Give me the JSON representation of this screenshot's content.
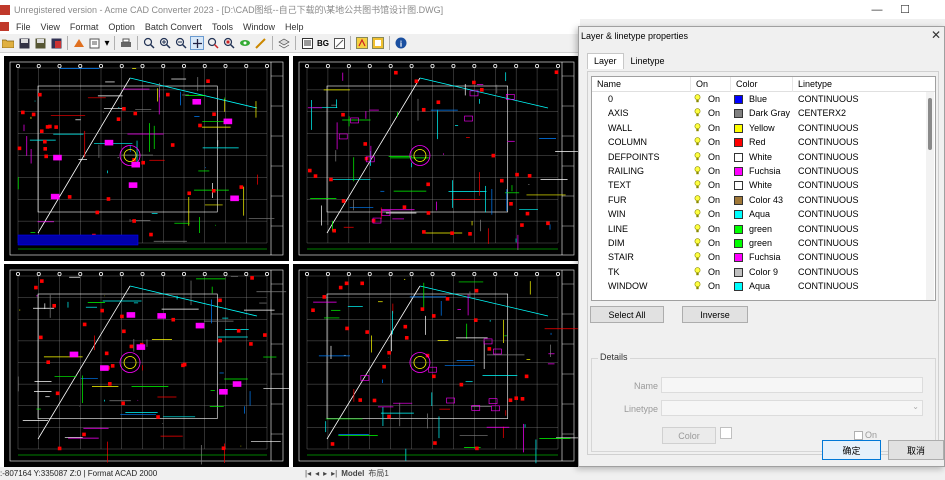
{
  "window": {
    "title": "Unregistered version - Acme CAD Converter 2023 - [D:\\CAD图纸--自己下载的\\某地公共图书馆设计图.DWG]"
  },
  "menu": [
    "File",
    "View",
    "Format",
    "Option",
    "Batch Convert",
    "Tools",
    "Window",
    "Help"
  ],
  "status": {
    "coords": ":-807164 Y:335087 Z:0 | Format ACAD 2000",
    "nav": [
      "|◂",
      "◂",
      "▸",
      "▸|"
    ],
    "tabs": [
      "Model",
      "布局1"
    ]
  },
  "dialog": {
    "title": "Layer & linetype properties",
    "tabs": [
      "Layer",
      "Linetype"
    ],
    "columns": [
      "Name",
      "On",
      "Color",
      "Linetype"
    ],
    "layers": [
      {
        "name": "0",
        "on": "On",
        "color_name": "Blue",
        "color": "#0000ff",
        "linetype": "CONTINUOUS"
      },
      {
        "name": "AXIS",
        "on": "On",
        "color_name": "Dark Gray",
        "color": "#808080",
        "linetype": "CENTERX2"
      },
      {
        "name": "WALL",
        "on": "On",
        "color_name": "Yellow",
        "color": "#ffff00",
        "linetype": "CONTINUOUS"
      },
      {
        "name": "COLUMN",
        "on": "On",
        "color_name": "Red",
        "color": "#ff0000",
        "linetype": "CONTINUOUS"
      },
      {
        "name": "DEFPOINTS",
        "on": "On",
        "color_name": "White",
        "color": "#ffffff",
        "linetype": "CONTINUOUS"
      },
      {
        "name": "RAILING",
        "on": "On",
        "color_name": "Fuchsia",
        "color": "#ff00ff",
        "linetype": "CONTINUOUS"
      },
      {
        "name": "TEXT",
        "on": "On",
        "color_name": "White",
        "color": "#ffffff",
        "linetype": "CONTINUOUS"
      },
      {
        "name": "FUR",
        "on": "On",
        "color_name": "Color 43",
        "color": "#a07838",
        "linetype": "CONTINUOUS"
      },
      {
        "name": "WIN",
        "on": "On",
        "color_name": "Aqua",
        "color": "#00ffff",
        "linetype": "CONTINUOUS"
      },
      {
        "name": "LINE",
        "on": "On",
        "color_name": "green",
        "color": "#00ff00",
        "linetype": "CONTINUOUS"
      },
      {
        "name": "DIM",
        "on": "On",
        "color_name": "green",
        "color": "#00ff00",
        "linetype": "CONTINUOUS"
      },
      {
        "name": "STAIR",
        "on": "On",
        "color_name": "Fuchsia",
        "color": "#ff00ff",
        "linetype": "CONTINUOUS"
      },
      {
        "name": "TK",
        "on": "On",
        "color_name": "Color 9",
        "color": "#c0c0c0",
        "linetype": "CONTINUOUS"
      },
      {
        "name": "WINDOW",
        "on": "On",
        "color_name": "Aqua",
        "color": "#00ffff",
        "linetype": "CONTINUOUS"
      }
    ],
    "select_all": "Select All",
    "inverse": "Inverse",
    "details": {
      "title": "Details",
      "name_label": "Name",
      "linetype_label": "Linetype",
      "color_label": "Color",
      "on_label": "On"
    },
    "ok": "确定",
    "cancel": "取消"
  }
}
